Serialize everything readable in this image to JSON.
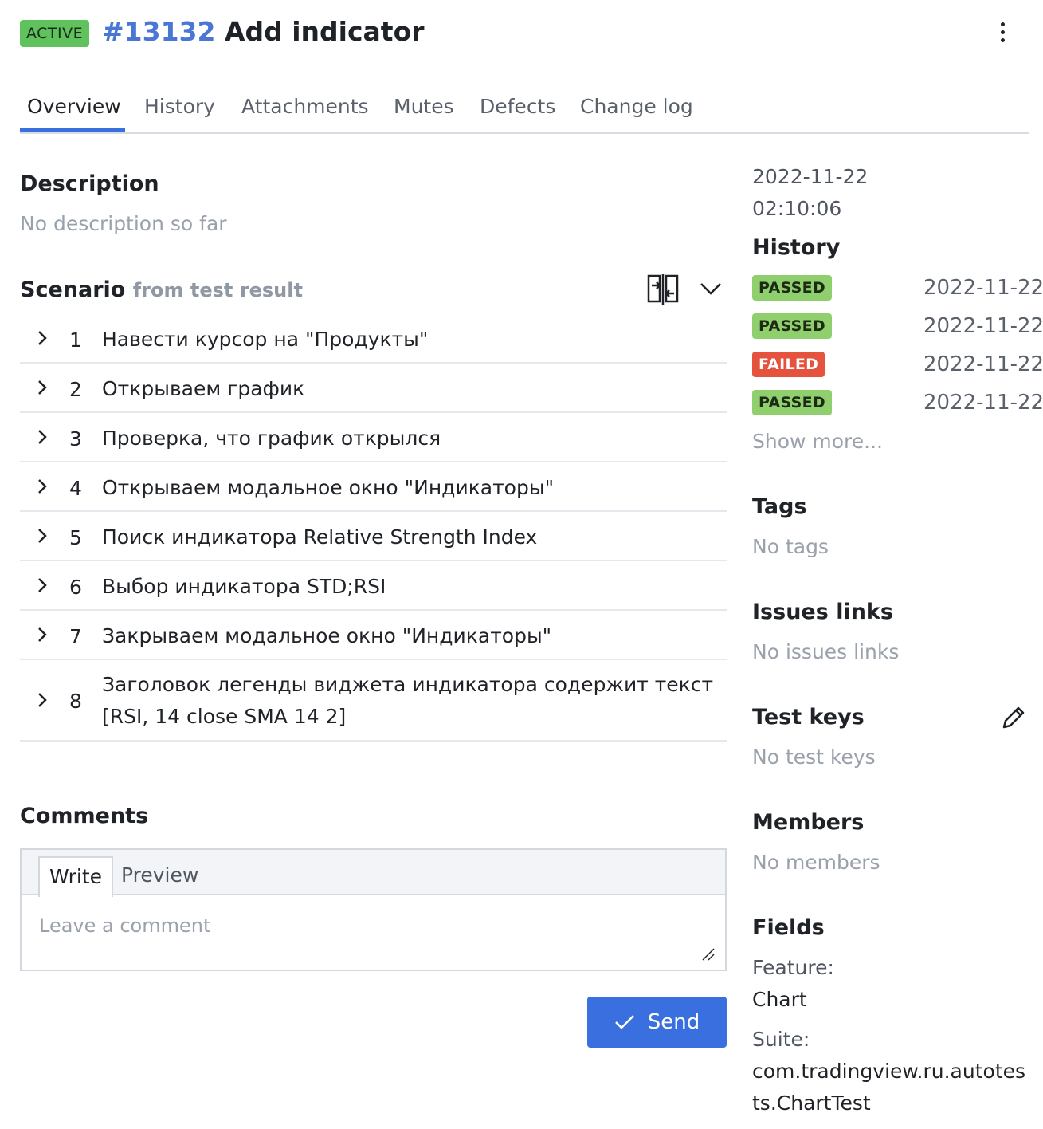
{
  "header": {
    "status": "ACTIVE",
    "id": "#13132",
    "title": "Add indicator",
    "status_color": "#5fc25c",
    "menu_icon": "kebab-menu-icon"
  },
  "tabs": [
    "Overview",
    "History",
    "Attachments",
    "Mutes",
    "Defects",
    "Change log"
  ],
  "active_tab": "Overview",
  "description": {
    "heading": "Description",
    "empty_text": "No description so far"
  },
  "scenario": {
    "heading": "Scenario",
    "subheading": "from test result",
    "steps": [
      {
        "num": "1",
        "text": "Навести курсор на \"Продукты\""
      },
      {
        "num": "2",
        "text": "Открываем график"
      },
      {
        "num": "3",
        "text": "Проверка, что график открылся"
      },
      {
        "num": "4",
        "text": "Открываем модальное окно \"Индикаторы\""
      },
      {
        "num": "5",
        "text": "Поиск индикатора Relative Strength Index"
      },
      {
        "num": "6",
        "text": "Выбор индикатора STD;RSI"
      },
      {
        "num": "7",
        "text": "Закрываем модальное окно \"Индикаторы\""
      },
      {
        "num": "8",
        "text": "Заголовок легенды виджета индикатора содержит текст [RSI, 14 close SMA 14 2]"
      }
    ]
  },
  "comments": {
    "heading": "Comments",
    "tab_write": "Write",
    "tab_preview": "Preview",
    "placeholder": "Leave a comment",
    "send_label": "Send"
  },
  "sidebar": {
    "date": "2022-11-22",
    "time": "02:10:06",
    "history_heading": "History",
    "history": [
      {
        "status": "PASSED",
        "date": "2022-11-22"
      },
      {
        "status": "PASSED",
        "date": "2022-11-22"
      },
      {
        "status": "FAILED",
        "date": "2022-11-22"
      },
      {
        "status": "PASSED",
        "date": "2022-11-22"
      }
    ],
    "show_more": "Show more...",
    "tags_heading": "Tags",
    "tags_empty": "No tags",
    "issues_heading": "Issues links",
    "issues_empty": "No issues links",
    "testkeys_heading": "Test keys",
    "testkeys_empty": "No test keys",
    "members_heading": "Members",
    "members_empty": "No members",
    "fields_heading": "Fields",
    "feature_label": "Feature:",
    "feature_value": "Chart",
    "suite_label": "Suite:",
    "suite_value_1": "com.tradingview.ru.autotes",
    "suite_value_2": "ts.ChartTest"
  },
  "colors": {
    "accent": "#3a6fe0",
    "passed": "#8fcf6d",
    "failed": "#e5523e"
  }
}
